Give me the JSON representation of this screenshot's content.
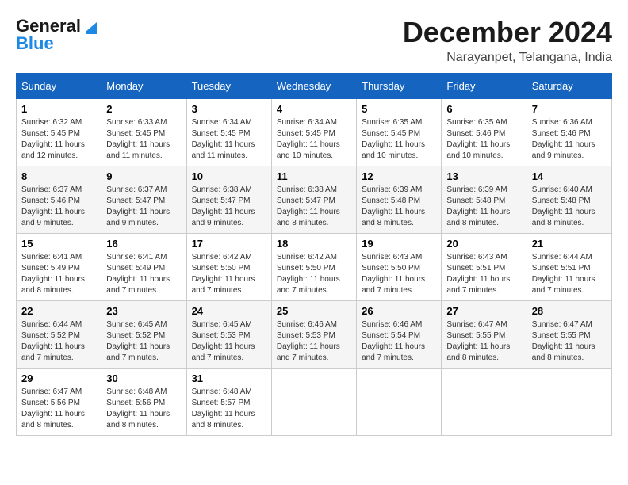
{
  "logo": {
    "line1": "General",
    "line2": "Blue"
  },
  "title": "December 2024",
  "location": "Narayanpet, Telangana, India",
  "days_of_week": [
    "Sunday",
    "Monday",
    "Tuesday",
    "Wednesday",
    "Thursday",
    "Friday",
    "Saturday"
  ],
  "weeks": [
    [
      {
        "day": "1",
        "sunrise": "6:32 AM",
        "sunset": "5:45 PM",
        "daylight": "11 hours and 12 minutes."
      },
      {
        "day": "2",
        "sunrise": "6:33 AM",
        "sunset": "5:45 PM",
        "daylight": "11 hours and 11 minutes."
      },
      {
        "day": "3",
        "sunrise": "6:34 AM",
        "sunset": "5:45 PM",
        "daylight": "11 hours and 11 minutes."
      },
      {
        "day": "4",
        "sunrise": "6:34 AM",
        "sunset": "5:45 PM",
        "daylight": "11 hours and 10 minutes."
      },
      {
        "day": "5",
        "sunrise": "6:35 AM",
        "sunset": "5:45 PM",
        "daylight": "11 hours and 10 minutes."
      },
      {
        "day": "6",
        "sunrise": "6:35 AM",
        "sunset": "5:46 PM",
        "daylight": "11 hours and 10 minutes."
      },
      {
        "day": "7",
        "sunrise": "6:36 AM",
        "sunset": "5:46 PM",
        "daylight": "11 hours and 9 minutes."
      }
    ],
    [
      {
        "day": "8",
        "sunrise": "6:37 AM",
        "sunset": "5:46 PM",
        "daylight": "11 hours and 9 minutes."
      },
      {
        "day": "9",
        "sunrise": "6:37 AM",
        "sunset": "5:47 PM",
        "daylight": "11 hours and 9 minutes."
      },
      {
        "day": "10",
        "sunrise": "6:38 AM",
        "sunset": "5:47 PM",
        "daylight": "11 hours and 9 minutes."
      },
      {
        "day": "11",
        "sunrise": "6:38 AM",
        "sunset": "5:47 PM",
        "daylight": "11 hours and 8 minutes."
      },
      {
        "day": "12",
        "sunrise": "6:39 AM",
        "sunset": "5:48 PM",
        "daylight": "11 hours and 8 minutes."
      },
      {
        "day": "13",
        "sunrise": "6:39 AM",
        "sunset": "5:48 PM",
        "daylight": "11 hours and 8 minutes."
      },
      {
        "day": "14",
        "sunrise": "6:40 AM",
        "sunset": "5:48 PM",
        "daylight": "11 hours and 8 minutes."
      }
    ],
    [
      {
        "day": "15",
        "sunrise": "6:41 AM",
        "sunset": "5:49 PM",
        "daylight": "11 hours and 8 minutes."
      },
      {
        "day": "16",
        "sunrise": "6:41 AM",
        "sunset": "5:49 PM",
        "daylight": "11 hours and 7 minutes."
      },
      {
        "day": "17",
        "sunrise": "6:42 AM",
        "sunset": "5:50 PM",
        "daylight": "11 hours and 7 minutes."
      },
      {
        "day": "18",
        "sunrise": "6:42 AM",
        "sunset": "5:50 PM",
        "daylight": "11 hours and 7 minutes."
      },
      {
        "day": "19",
        "sunrise": "6:43 AM",
        "sunset": "5:50 PM",
        "daylight": "11 hours and 7 minutes."
      },
      {
        "day": "20",
        "sunrise": "6:43 AM",
        "sunset": "5:51 PM",
        "daylight": "11 hours and 7 minutes."
      },
      {
        "day": "21",
        "sunrise": "6:44 AM",
        "sunset": "5:51 PM",
        "daylight": "11 hours and 7 minutes."
      }
    ],
    [
      {
        "day": "22",
        "sunrise": "6:44 AM",
        "sunset": "5:52 PM",
        "daylight": "11 hours and 7 minutes."
      },
      {
        "day": "23",
        "sunrise": "6:45 AM",
        "sunset": "5:52 PM",
        "daylight": "11 hours and 7 minutes."
      },
      {
        "day": "24",
        "sunrise": "6:45 AM",
        "sunset": "5:53 PM",
        "daylight": "11 hours and 7 minutes."
      },
      {
        "day": "25",
        "sunrise": "6:46 AM",
        "sunset": "5:53 PM",
        "daylight": "11 hours and 7 minutes."
      },
      {
        "day": "26",
        "sunrise": "6:46 AM",
        "sunset": "5:54 PM",
        "daylight": "11 hours and 7 minutes."
      },
      {
        "day": "27",
        "sunrise": "6:47 AM",
        "sunset": "5:55 PM",
        "daylight": "11 hours and 8 minutes."
      },
      {
        "day": "28",
        "sunrise": "6:47 AM",
        "sunset": "5:55 PM",
        "daylight": "11 hours and 8 minutes."
      }
    ],
    [
      {
        "day": "29",
        "sunrise": "6:47 AM",
        "sunset": "5:56 PM",
        "daylight": "11 hours and 8 minutes."
      },
      {
        "day": "30",
        "sunrise": "6:48 AM",
        "sunset": "5:56 PM",
        "daylight": "11 hours and 8 minutes."
      },
      {
        "day": "31",
        "sunrise": "6:48 AM",
        "sunset": "5:57 PM",
        "daylight": "11 hours and 8 minutes."
      },
      null,
      null,
      null,
      null
    ]
  ]
}
